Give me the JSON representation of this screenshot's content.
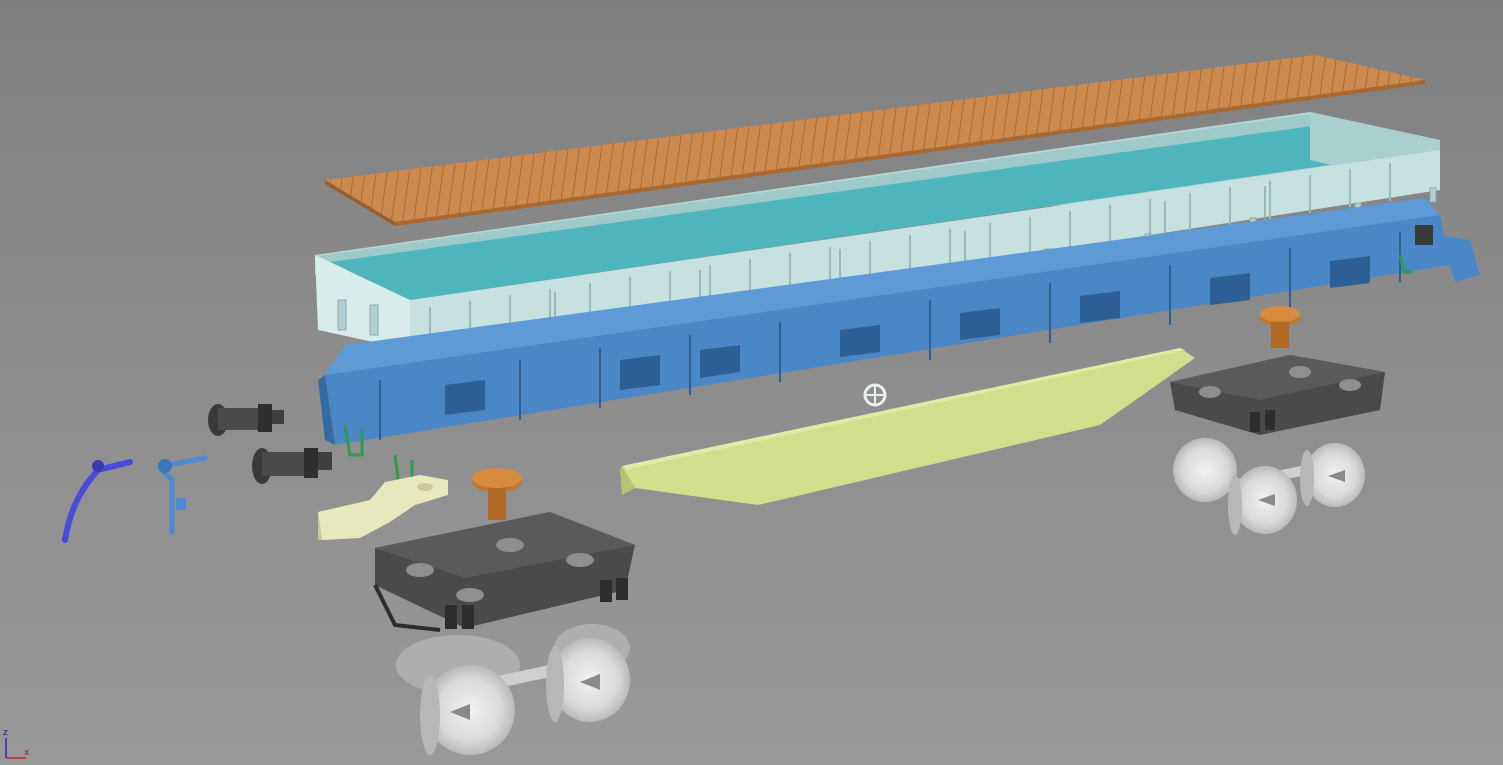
{
  "viewport": {
    "background_top": "#7f7f7f",
    "background_bottom": "#999999"
  },
  "colors": {
    "deck": "#cd8a4f",
    "deck_lines": "#9b5e2b",
    "side_walls": "#c7e1e1",
    "floor": "#4eb5bd",
    "frame": "#4a87c7",
    "frame_dark": "#356aa3",
    "beam": "#d2de8c",
    "bolster": "#c0772c",
    "bogie": "#4a4a4a",
    "bogie_dark": "#2d2d2d",
    "wheels": "#dedede",
    "coupler": "#e8e8bd",
    "buffers": "#3f3f3f",
    "hose_dark": "#4a4adb",
    "hose_light": "#4a8ad0",
    "green_parts": "#2f9a4f"
  },
  "parts": [
    "floor-planks",
    "body-side-walls",
    "underframe",
    "center-beam",
    "bogie-front",
    "bogie-rear",
    "wheelset-front",
    "wheelset-rear",
    "buffers",
    "coupler",
    "brake-hoses",
    "hand-brake-wheel"
  ],
  "axis_gizmo": {
    "z_label": "z",
    "x_label": "x"
  }
}
